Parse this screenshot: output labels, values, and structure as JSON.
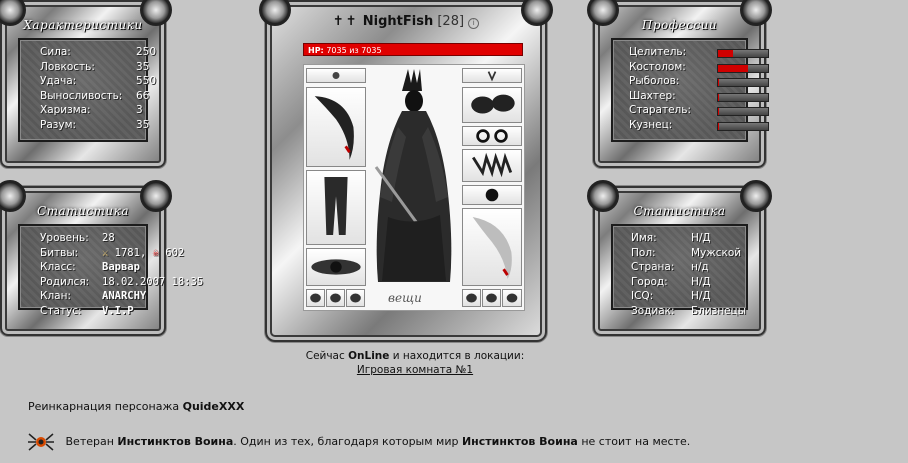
{
  "characteristics": {
    "title": "Характеристики",
    "rows": [
      {
        "label": "Сила:",
        "value": "250"
      },
      {
        "label": "Ловкость:",
        "value": "35"
      },
      {
        "label": "Удача:",
        "value": "550"
      },
      {
        "label": "Выносливость:",
        "value": "66"
      },
      {
        "label": "Харизма:",
        "value": "3"
      },
      {
        "label": "Разум:",
        "value": "35"
      }
    ]
  },
  "stats_left": {
    "title": "Статистика",
    "level_label": "Уровень:",
    "level_value": "28",
    "battles_label": "Битвы:",
    "wins": "1781,",
    "losses": "602",
    "class_label": "Класс:",
    "class_value": "Варвар",
    "born_label": "Родился:",
    "born_value": "18.02.2007 18:35",
    "clan_label": "Клан:",
    "clan_value": "ANARCHY",
    "status_label": "Статус:",
    "status_value": "V.I.P"
  },
  "character": {
    "name": "NightFish",
    "level": "[28]",
    "hp_label": "HP:",
    "hp_text": "7035 из 7035",
    "hp_fraction": 1.0,
    "items_label": "вещи"
  },
  "professions": {
    "title": "Профессии",
    "rows": [
      {
        "label": "Целитель:",
        "level": 0.3
      },
      {
        "label": "Костолом:",
        "level": 0.6
      },
      {
        "label": "Рыболов:",
        "level": 0.02
      },
      {
        "label": "Шахтер:",
        "level": 0.02
      },
      {
        "label": "Старатель:",
        "level": 0.02
      },
      {
        "label": "Кузнец:",
        "level": 0.02
      }
    ],
    "bar_color": "#d00000"
  },
  "stats_right": {
    "title": "Статистика",
    "rows": [
      {
        "label": "Имя:",
        "value": "Н/Д"
      },
      {
        "label": "Пол:",
        "value": "Мужской"
      },
      {
        "label": "Страна:",
        "value": "н/д"
      },
      {
        "label": "Город:",
        "value": "Н/Д"
      },
      {
        "label": "ICQ:",
        "value": "Н/Д"
      },
      {
        "label": "Зодиак:",
        "value": "Близнецы"
      }
    ]
  },
  "online": {
    "prefix": "Сейчас",
    "status": "OnLine",
    "middle": "и находится в локации:",
    "location": "Игровая комната №1"
  },
  "reincarnation": {
    "text": "Реинкарнация персонажа",
    "name": "QuideXXX"
  },
  "veteran": {
    "t1": "Ветеран",
    "b1": "Инстинктов Воина",
    "t2": ". Один из тех, благодаря которым мир",
    "b2": "Инстинктов Воина",
    "t3": "не стоит на месте."
  }
}
